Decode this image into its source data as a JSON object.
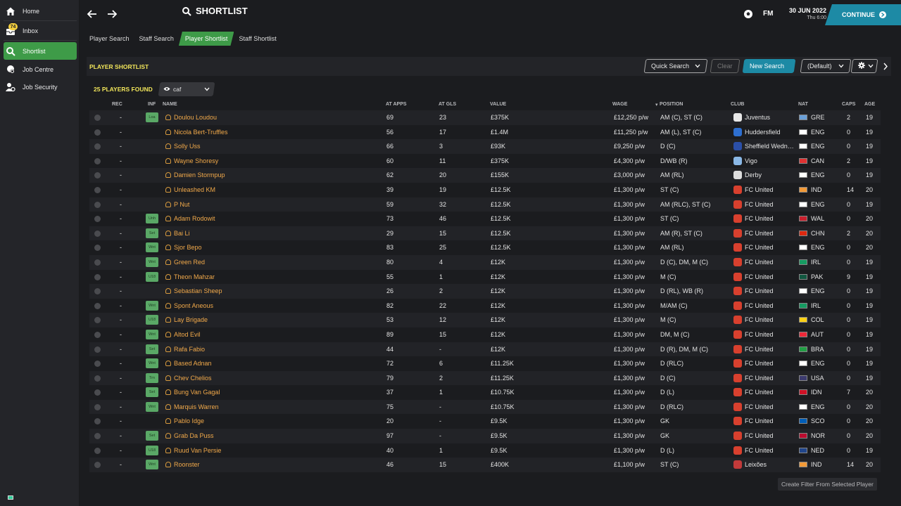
{
  "sidebar": {
    "items": [
      {
        "label": "Home",
        "icon": "home-icon"
      },
      {
        "label": "Inbox",
        "icon": "inbox-icon"
      },
      {
        "label": "Shortlist",
        "icon": "search-icon"
      },
      {
        "label": "Job Centre",
        "icon": "job-centre-icon"
      },
      {
        "label": "Job Security",
        "icon": "job-security-icon"
      }
    ],
    "inbox_badge": "74",
    "active_item": "Shortlist"
  },
  "header": {
    "title": "SHORTLIST",
    "logo": "FM",
    "date": "30 JUN 2022",
    "time": "Thu 6:00",
    "continue_label": "CONTINUE"
  },
  "subtabs": [
    {
      "label": "Player Search",
      "active": false
    },
    {
      "label": "Staff Search",
      "active": false
    },
    {
      "label": "Player Shortlist",
      "active": true
    },
    {
      "label": "Staff Shortlist",
      "active": false
    }
  ],
  "panel": {
    "title": "PLAYER SHORTLIST",
    "quick_search": "Quick Search",
    "clear": "Clear",
    "new_search": "New Search",
    "view_default": "(Default)",
    "players_found": "25 PLAYERS FOUND",
    "view_name": "caf"
  },
  "columns": [
    "REC",
    "INF",
    "NAME",
    "AT APPS",
    "AT GLS",
    "VALUE",
    "WAGE",
    "POSITION",
    "CLUB",
    "NAT",
    "CAPS",
    "AGE"
  ],
  "rows": [
    {
      "rec": "-",
      "inf": "Loa",
      "name": "Doulou Loudou",
      "apps": "69",
      "gls": "23",
      "value": "£375K",
      "wage": "£12,250 p/w",
      "position": "AM (C), ST (C)",
      "club": "Juventus",
      "club_color": "#e8e8e8",
      "nat": "GRE",
      "flag": "#6aa0d8",
      "caps": "2",
      "age": "19"
    },
    {
      "rec": "-",
      "inf": "",
      "name": "Nicola Bert-Truffles",
      "apps": "56",
      "gls": "17",
      "value": "£1.4M",
      "wage": "£11,250 p/w",
      "position": "AM (L), ST (C)",
      "club": "Huddersfield",
      "club_color": "#2e6fd0",
      "nat": "ENG",
      "flag": "#ffffff",
      "caps": "0",
      "age": "19"
    },
    {
      "rec": "-",
      "inf": "",
      "name": "Solly Uss",
      "apps": "66",
      "gls": "3",
      "value": "£93K",
      "wage": "£9,250 p/w",
      "position": "D (C)",
      "club": "Sheffield Wedn…",
      "club_color": "#2b4fa8",
      "nat": "ENG",
      "flag": "#ffffff",
      "caps": "0",
      "age": "19"
    },
    {
      "rec": "-",
      "inf": "",
      "name": "Wayne Shoresy",
      "apps": "60",
      "gls": "11",
      "value": "£375K",
      "wage": "£4,300 p/w",
      "position": "D/WB (R)",
      "club": "Vigo",
      "club_color": "#8ab8e6",
      "nat": "CAN",
      "flag": "#e03232",
      "caps": "2",
      "age": "19"
    },
    {
      "rec": "-",
      "inf": "",
      "name": "Damien Stormpup",
      "apps": "62",
      "gls": "20",
      "value": "£155K",
      "wage": "£3,000 p/w",
      "position": "AM (RL)",
      "club": "Derby",
      "club_color": "#dddddd",
      "nat": "ENG",
      "flag": "#ffffff",
      "caps": "0",
      "age": "19"
    },
    {
      "rec": "-",
      "inf": "",
      "name": "Unleashed KM",
      "apps": "39",
      "gls": "19",
      "value": "£12.5K",
      "wage": "£1,300 p/w",
      "position": "ST (C)",
      "club": "FC United",
      "club_color": "#d8402e",
      "nat": "IND",
      "flag": "#f29a38",
      "caps": "14",
      "age": "20"
    },
    {
      "rec": "-",
      "inf": "",
      "name": "P Nut",
      "apps": "59",
      "gls": "32",
      "value": "£12.5K",
      "wage": "£1,300 p/w",
      "position": "AM (RLC), ST (C)",
      "club": "FC United",
      "club_color": "#d8402e",
      "nat": "ENG",
      "flag": "#ffffff",
      "caps": "0",
      "age": "19"
    },
    {
      "rec": "-",
      "inf": "Unh",
      "name": "Adam Rodowit",
      "apps": "73",
      "gls": "46",
      "value": "£12.5K",
      "wage": "£1,300 p/w",
      "position": "ST (C)",
      "club": "FC United",
      "club_color": "#d8402e",
      "nat": "WAL",
      "flag": "#c8202e",
      "caps": "0",
      "age": "20"
    },
    {
      "rec": "-",
      "inf": "Set",
      "name": "Bai Li",
      "apps": "29",
      "gls": "15",
      "value": "£12.5K",
      "wage": "£1,300 p/w",
      "position": "AM (R), ST (C)",
      "club": "FC United",
      "club_color": "#d8402e",
      "nat": "CHN",
      "flag": "#de2910",
      "caps": "2",
      "age": "20"
    },
    {
      "rec": "-",
      "inf": "Wnt",
      "name": "Sjor Bepo",
      "apps": "83",
      "gls": "25",
      "value": "£12.5K",
      "wage": "£1,300 p/w",
      "position": "AM (RL)",
      "club": "FC United",
      "club_color": "#d8402e",
      "nat": "ENG",
      "flag": "#ffffff",
      "caps": "0",
      "age": "20"
    },
    {
      "rec": "-",
      "inf": "Wnt",
      "name": "Green Red",
      "apps": "80",
      "gls": "4",
      "value": "£12K",
      "wage": "£1,300 p/w",
      "position": "D (C), DM, M (C)",
      "club": "FC United",
      "club_color": "#d8402e",
      "nat": "IRL",
      "flag": "#169b62",
      "caps": "0",
      "age": "19"
    },
    {
      "rec": "-",
      "inf": "U18",
      "name": "Theon Mahzar",
      "apps": "55",
      "gls": "1",
      "value": "£12K",
      "wage": "£1,300 p/w",
      "position": "M (C)",
      "club": "FC United",
      "club_color": "#d8402e",
      "nat": "PAK",
      "flag": "#115740",
      "caps": "9",
      "age": "19"
    },
    {
      "rec": "-",
      "inf": "",
      "name": "Sebastian Sheep",
      "apps": "26",
      "gls": "2",
      "value": "£12K",
      "wage": "£1,300 p/w",
      "position": "D (RL), WB (R)",
      "club": "FC United",
      "club_color": "#d8402e",
      "nat": "ENG",
      "flag": "#ffffff",
      "caps": "0",
      "age": "19"
    },
    {
      "rec": "-",
      "inf": "Wnt",
      "name": "Spont Aneous",
      "apps": "82",
      "gls": "22",
      "value": "£12K",
      "wage": "£1,300 p/w",
      "position": "M/AM (C)",
      "club": "FC United",
      "club_color": "#d8402e",
      "nat": "IRL",
      "flag": "#169b62",
      "caps": "0",
      "age": "19"
    },
    {
      "rec": "-",
      "inf": "U18",
      "name": "Lay Brigade",
      "apps": "53",
      "gls": "12",
      "value": "£12K",
      "wage": "£1,300 p/w",
      "position": "M (C)",
      "club": "FC United",
      "club_color": "#d8402e",
      "nat": "COL",
      "flag": "#fcd116",
      "caps": "0",
      "age": "19"
    },
    {
      "rec": "-",
      "inf": "Wnt",
      "name": "Altod Evil",
      "apps": "89",
      "gls": "15",
      "value": "£12K",
      "wage": "£1,300 p/w",
      "position": "DM, M (C)",
      "club": "FC United",
      "club_color": "#d8402e",
      "nat": "AUT",
      "flag": "#ed2939",
      "caps": "0",
      "age": "19"
    },
    {
      "rec": "-",
      "inf": "Set",
      "name": "Rafa Fabio",
      "apps": "44",
      "gls": "-",
      "value": "£12K",
      "wage": "£1,300 p/w",
      "position": "D (R), DM, M (C)",
      "club": "FC United",
      "club_color": "#d8402e",
      "nat": "BRA",
      "flag": "#229e45",
      "caps": "0",
      "age": "19"
    },
    {
      "rec": "-",
      "inf": "Wnt",
      "name": "Based Adnan",
      "apps": "72",
      "gls": "6",
      "value": "£11.25K",
      "wage": "£1,300 p/w",
      "position": "D (RLC)",
      "club": "FC United",
      "club_color": "#d8402e",
      "nat": "ENG",
      "flag": "#ffffff",
      "caps": "0",
      "age": "19"
    },
    {
      "rec": "-",
      "inf": "Trn",
      "name": "Chev Chelios",
      "apps": "79",
      "gls": "2",
      "value": "£11.25K",
      "wage": "£1,300 p/w",
      "position": "D (C)",
      "club": "FC United",
      "club_color": "#d8402e",
      "nat": "USA",
      "flag": "#3c3b6e",
      "caps": "0",
      "age": "19"
    },
    {
      "rec": "-",
      "inf": "Set",
      "name": "Bung  Van Gagal",
      "apps": "37",
      "gls": "1",
      "value": "£10.75K",
      "wage": "£1,300 p/w",
      "position": "D (L)",
      "club": "FC United",
      "club_color": "#d8402e",
      "nat": "IDN",
      "flag": "#ce1126",
      "caps": "7",
      "age": "20"
    },
    {
      "rec": "-",
      "inf": "Wnt",
      "name": "Marquis Warren",
      "apps": "75",
      "gls": "-",
      "value": "£10.75K",
      "wage": "£1,300 p/w",
      "position": "D (RLC)",
      "club": "FC United",
      "club_color": "#d8402e",
      "nat": "ENG",
      "flag": "#ffffff",
      "caps": "0",
      "age": "20"
    },
    {
      "rec": "-",
      "inf": "",
      "name": "Pablo Idge",
      "apps": "20",
      "gls": "-",
      "value": "£9.5K",
      "wage": "£1,300 p/w",
      "position": "GK",
      "club": "FC United",
      "club_color": "#d8402e",
      "nat": "SCO",
      "flag": "#005eb8",
      "caps": "0",
      "age": "20"
    },
    {
      "rec": "-",
      "inf": "Set",
      "name": "Grab Da Puss",
      "apps": "97",
      "gls": "-",
      "value": "£9.5K",
      "wage": "£1,300 p/w",
      "position": "GK",
      "club": "FC United",
      "club_color": "#d8402e",
      "nat": "NOR",
      "flag": "#ba0c2f",
      "caps": "0",
      "age": "20"
    },
    {
      "rec": "-",
      "inf": "U18",
      "name": "Ruud Van Persie",
      "apps": "40",
      "gls": "1",
      "value": "£9.5K",
      "wage": "£1,300 p/w",
      "position": "D (L)",
      "club": "FC United",
      "club_color": "#d8402e",
      "nat": "NED",
      "flag": "#21468b",
      "caps": "0",
      "age": "19"
    },
    {
      "rec": "-",
      "inf": "Wnt",
      "name": "Roonster",
      "apps": "46",
      "gls": "15",
      "value": "£400K",
      "wage": "£1,100 p/w",
      "position": "ST (C)",
      "club": "Leixões",
      "club_color": "#c23a3a",
      "nat": "IND",
      "flag": "#f29a38",
      "caps": "14",
      "age": "20"
    }
  ],
  "filter_button": "Create Filter From Selected Player"
}
